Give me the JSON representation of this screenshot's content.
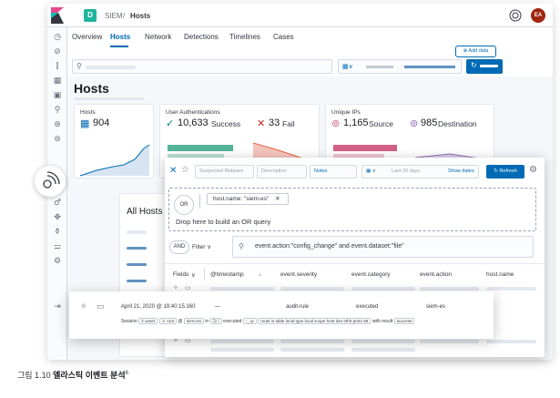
{
  "header": {
    "space_initial": "D",
    "breadcrumb_root": "SIEM",
    "breadcrumb_sep": "/",
    "breadcrumb_current": "Hosts",
    "avatar_initials": "EA"
  },
  "tabs": [
    "Overview",
    "Hosts",
    "Network",
    "Detections",
    "Timelines",
    "Cases"
  ],
  "add_data_label": "Add data",
  "page_title": "Hosts",
  "cards": {
    "hosts": {
      "label": "Hosts",
      "value": "904"
    },
    "auth": {
      "label": "User Authentications",
      "success_value": "10,633",
      "success_label": "Success",
      "fail_value": "33",
      "fail_label": "Fail"
    },
    "ips": {
      "label": "Unique IPs",
      "source_value": "1,165",
      "source_label": "Source",
      "dest_value": "985",
      "dest_label": "Destination"
    }
  },
  "all_hosts_title": "All Hosts",
  "timeline": {
    "title_placeholder": "Suspected Malware",
    "description_placeholder": "Description",
    "notes_label": "Notes",
    "date_range": "Last 30 days",
    "show_dates_label": "Show dates",
    "refresh_label": "Refresh",
    "or_label": "OR",
    "host_filter": "host.name: \"siem-es\"",
    "drop_hint": "Drop here to build an OR query",
    "and_label": "AND",
    "filter_label": "Filter",
    "query": "event.action:\"config_change\" and event.dataset:\"file\"",
    "columns": [
      "Fields",
      "@timestamp",
      "event.severity",
      "event.category",
      "event.action",
      "host.name"
    ]
  },
  "event_row": {
    "timestamp": "April 21, 2020 @ 19:40:15.160",
    "dash": "—",
    "category": "audit-rule",
    "action": "executed",
    "host": "siem-es",
    "session_label": "Session",
    "session_value": "unset",
    "user": "root",
    "at": "@",
    "host_pill": "siem-es",
    "in_label": "in",
    "dir_pill": "/",
    "executed_label": "executed",
    "process_pill": "ip",
    "args_pill": "route is table local type local scope host dev eth0 proto 66",
    "with_result_label": "with result",
    "result_pill": "success"
  },
  "caption": {
    "prefix": "그림 1.10",
    "title": "엘라스틱 이벤트 분석",
    "superscript": "6"
  },
  "colors": {
    "accent": "#006bb4",
    "success": "#017d73",
    "danger": "#bd271e",
    "teal": "#54b399",
    "pink": "#d36086",
    "purple": "#9170b8"
  }
}
